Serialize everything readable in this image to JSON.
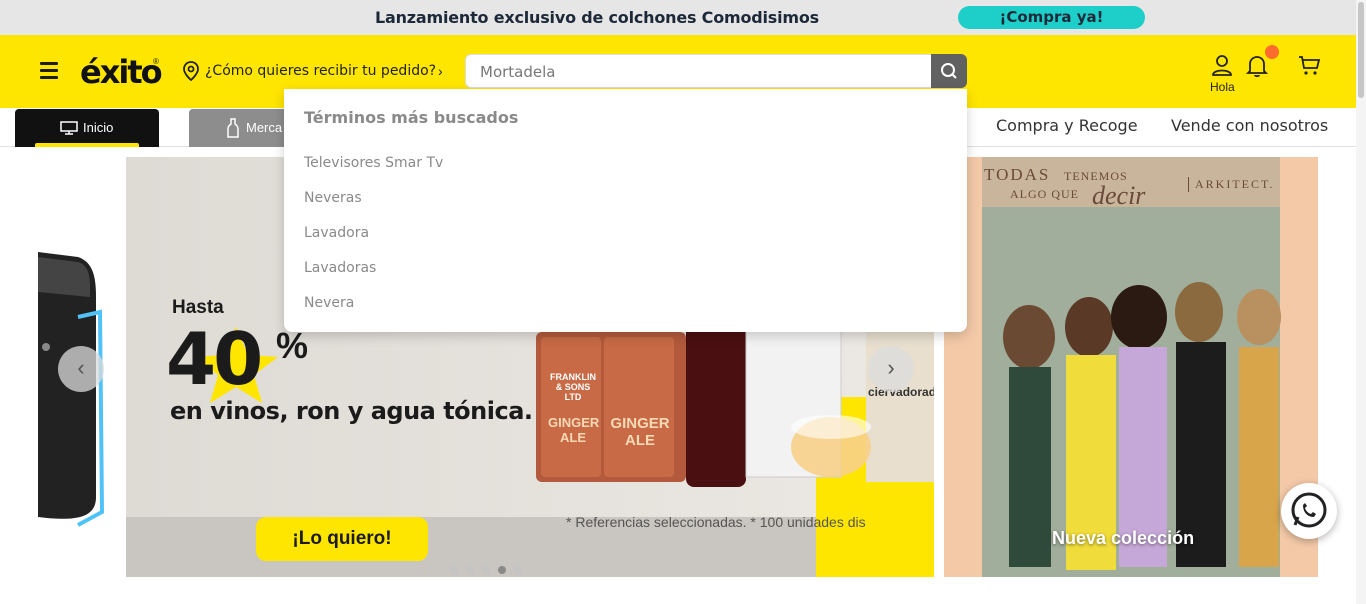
{
  "promo_bar": {
    "text": "Lanzamiento exclusivo de colchones Comodisimos",
    "cta": "¡Compra ya!"
  },
  "header": {
    "logo": "éxito",
    "location_prompt": "¿Cómo quieres recibir tu pedido?",
    "search_value": "Mortadela",
    "user_label": "Hola"
  },
  "nav": {
    "items": [
      {
        "label": "Inicio"
      },
      {
        "label": "Merca"
      },
      {
        "label": "Compra y Recoge"
      },
      {
        "label": "Vende con nosotros"
      }
    ]
  },
  "search_dropdown": {
    "title": "Términos más buscados",
    "terms": [
      "Televisores Smar Tv",
      "Neveras",
      "Lavadora",
      "Lavadoras",
      "Nevera"
    ]
  },
  "banner_main": {
    "pre_heading": "Hasta",
    "big_number": "40",
    "percent": "%",
    "subheading": "en vinos, ron y agua tónica.",
    "cta": "¡Lo quiero!",
    "footnote": "* Referencias seleccionadas. * 100 unidades dis",
    "product_labels": [
      "FRANKLIN & SONS LTD",
      "GINGER ALE",
      "GINGER ALE",
      "ciervadorada"
    ]
  },
  "banner_right": {
    "headline_a": "TODAS",
    "headline_b": "TENEMOS",
    "headline_c": "ALGO QUE",
    "headline_d": "decir",
    "brand": "ARKITECT.",
    "cta": "Nueva colección"
  },
  "carousel": {
    "dot_count": 5,
    "active_dot": 4
  },
  "colors": {
    "brand_yellow": "#ffe600",
    "promo_cta": "#1ecfc9",
    "notification_dot": "#ff6b2c"
  }
}
